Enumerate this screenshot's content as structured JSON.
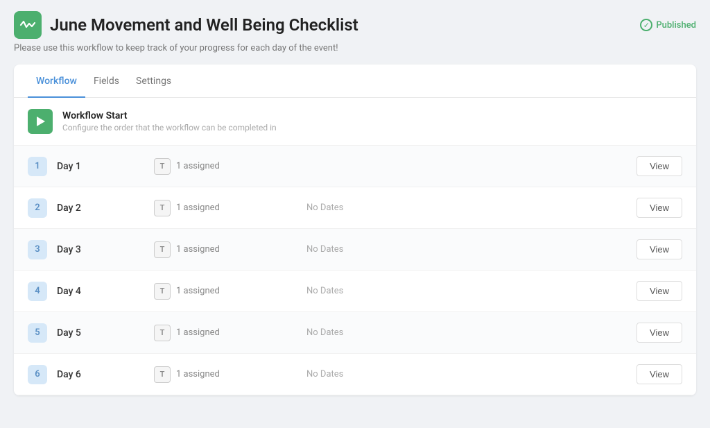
{
  "header": {
    "title": "June Movement and Well Being Checklist",
    "subtitle": "Please use this workflow to keep track of your progress for each day of the event!",
    "published_label": "Published"
  },
  "tabs": [
    {
      "id": "workflow",
      "label": "Workflow",
      "active": true
    },
    {
      "id": "fields",
      "label": "Fields",
      "active": false
    },
    {
      "id": "settings",
      "label": "Settings",
      "active": false
    }
  ],
  "workflow_start": {
    "title": "Workflow Start",
    "description": "Configure the order that the workflow can be completed in"
  },
  "days": [
    {
      "number": "1",
      "name": "Day 1",
      "assigned": "1 assigned",
      "no_dates": "",
      "view_label": "View",
      "show_dates": false
    },
    {
      "number": "2",
      "name": "Day 2",
      "assigned": "1 assigned",
      "no_dates": "No Dates",
      "view_label": "View",
      "show_dates": true
    },
    {
      "number": "3",
      "name": "Day 3",
      "assigned": "1 assigned",
      "no_dates": "No Dates",
      "view_label": "View",
      "show_dates": true
    },
    {
      "number": "4",
      "name": "Day 4",
      "assigned": "1 assigned",
      "no_dates": "No Dates",
      "view_label": "View",
      "show_dates": true
    },
    {
      "number": "5",
      "name": "Day 5",
      "assigned": "1 assigned",
      "no_dates": "No Dates",
      "view_label": "View",
      "show_dates": true
    },
    {
      "number": "6",
      "name": "Day 6",
      "assigned": "1 assigned",
      "no_dates": "No Dates",
      "view_label": "View",
      "show_dates": true
    }
  ],
  "type_badge_label": "T",
  "colors": {
    "active_tab": "#4a90d9",
    "play_icon_bg": "#4caf6e",
    "day_badge_bg": "#d6e8f8",
    "day_badge_color": "#5a8fc4"
  }
}
